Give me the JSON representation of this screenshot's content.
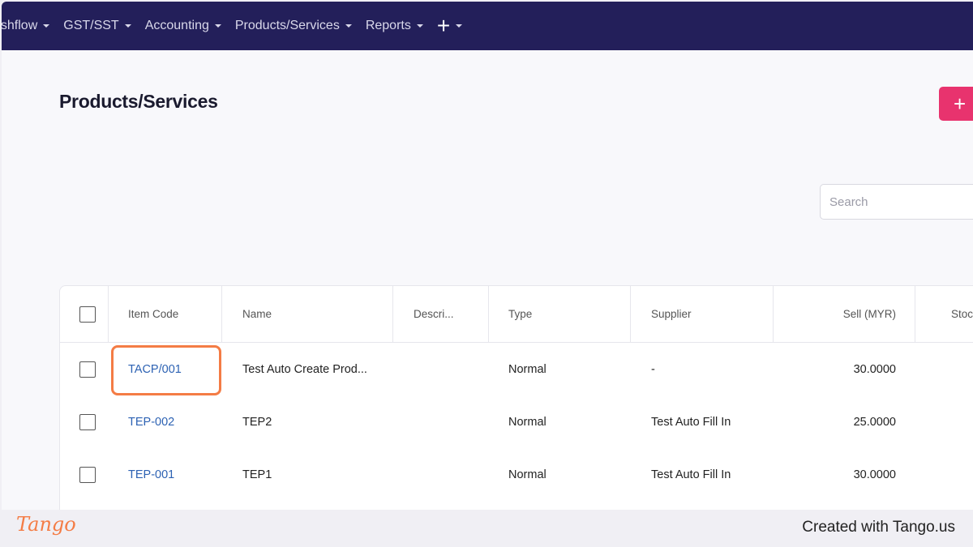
{
  "nav": {
    "items": [
      {
        "label": "ashflow"
      },
      {
        "label": "GST/SST"
      },
      {
        "label": "Accounting"
      },
      {
        "label": "Products/Services"
      },
      {
        "label": "Reports"
      }
    ],
    "add_icon": "plus-icon"
  },
  "page": {
    "title": "Products/Services",
    "add_button_icon": "+"
  },
  "search": {
    "placeholder": "Search"
  },
  "table": {
    "columns": [
      "Item Code",
      "Name",
      "Descri...",
      "Type",
      "Supplier",
      "Sell (MYR)",
      "Stoc"
    ],
    "rows": [
      {
        "item_code": "TACP/001",
        "name": "Test Auto Create Prod...",
        "description": "",
        "type": "Normal",
        "supplier": "-",
        "sell": "30.0000"
      },
      {
        "item_code": "TEP-002",
        "name": "TEP2",
        "description": "",
        "type": "Normal",
        "supplier": "Test Auto Fill In",
        "sell": "25.0000"
      },
      {
        "item_code": "TEP-001",
        "name": "TEP1",
        "description": "",
        "type": "Normal",
        "supplier": "Test Auto Fill In",
        "sell": "30.0000"
      }
    ]
  },
  "footer": {
    "logo": "Tango",
    "credit": "Created with Tango.us"
  },
  "colors": {
    "nav_bg": "#231f5a",
    "accent": "#e8336e",
    "link": "#2d62b3",
    "highlight": "#f47c45"
  }
}
